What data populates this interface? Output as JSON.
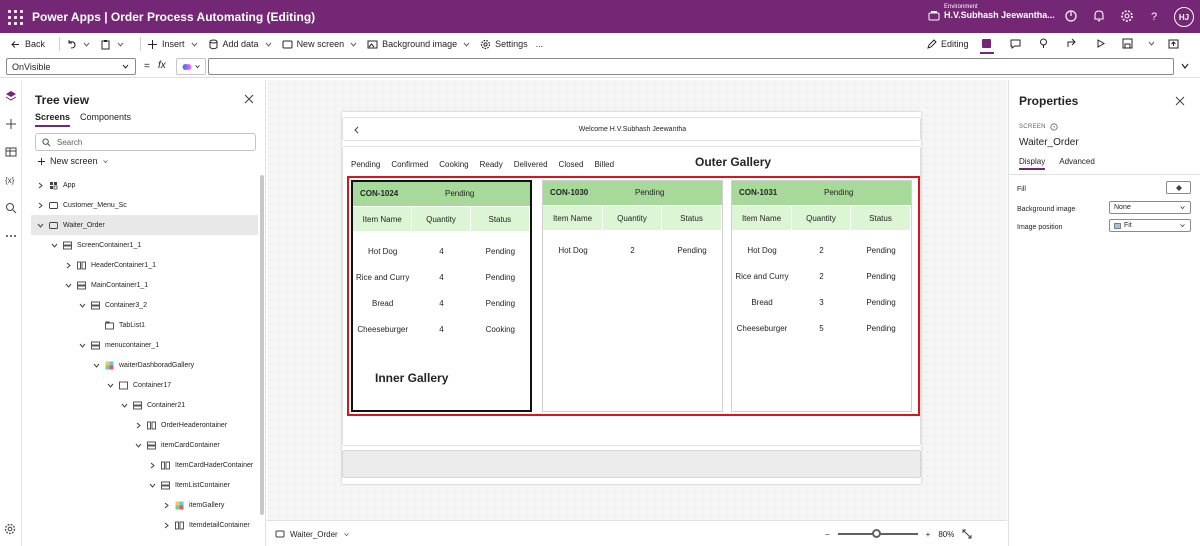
{
  "app": {
    "title": "Power Apps  |  Order Process Automating (Editing)",
    "env_label": "Environment",
    "env_value": "H.V.Subhash Jeewantha...",
    "avatar_initials": "HJ"
  },
  "commands": {
    "back": "Back",
    "insert": "Insert",
    "add_data": "Add data",
    "new_screen": "New screen",
    "background_image": "Background image",
    "settings": "Settings",
    "more": "...",
    "editing": "Editing"
  },
  "formula": {
    "property": "OnVisible",
    "fx": "fx",
    "value": ""
  },
  "tree": {
    "title": "Tree view",
    "tabs": [
      "Screens",
      "Components"
    ],
    "search_placeholder": "Search",
    "new_screen": "New screen",
    "nodes": [
      {
        "label": "App"
      },
      {
        "label": "Customer_Menu_Sc"
      },
      {
        "label": "Waiter_Order"
      },
      {
        "label": "ScreenContainer1_1"
      },
      {
        "label": "HeaderContainer1_1"
      },
      {
        "label": "MainContainer1_1"
      },
      {
        "label": "Container3_2"
      },
      {
        "label": "TabList1"
      },
      {
        "label": "menucontainer_1"
      },
      {
        "label": "waiterDashboradGallery"
      },
      {
        "label": "Container17"
      },
      {
        "label": "Container21"
      },
      {
        "label": "OrderHeaderontainer"
      },
      {
        "label": "itemCardContainer"
      },
      {
        "label": "ItemCardHaderContainer"
      },
      {
        "label": "ItemListContainer"
      },
      {
        "label": "itemGallery"
      },
      {
        "label": "ItemdetailContainer"
      }
    ]
  },
  "canvas": {
    "welcome": "Welcome H.V.Subhash Jeewantha",
    "status_tabs": [
      "Pending",
      "Confirmed",
      "Cooking",
      "Ready",
      "Delivered",
      "Closed",
      "Billed"
    ],
    "outer_label": "Outer Gallery",
    "inner_label": "Inner Gallery",
    "columns": [
      "Item Name",
      "Quantity",
      "Status"
    ],
    "orders": [
      {
        "id": "CON-1024",
        "status": "Pending",
        "items": [
          {
            "name": "Hot Dog",
            "qty": "4",
            "status": "Pending"
          },
          {
            "name": "Rice and Curry",
            "qty": "4",
            "status": "Pending"
          },
          {
            "name": "Bread",
            "qty": "4",
            "status": "Pending"
          },
          {
            "name": "Cheeseburger",
            "qty": "4",
            "status": "Cooking"
          }
        ]
      },
      {
        "id": "CON-1030",
        "status": "Pending",
        "items": [
          {
            "name": "Hot Dog",
            "qty": "2",
            "status": "Pending"
          }
        ]
      },
      {
        "id": "CON-1031",
        "status": "Pending",
        "items": [
          {
            "name": "Hot Dog",
            "qty": "2",
            "status": "Pending"
          },
          {
            "name": "Rice and Curry",
            "qty": "2",
            "status": "Pending"
          },
          {
            "name": "Bread",
            "qty": "3",
            "status": "Pending"
          },
          {
            "name": "Cheeseburger",
            "qty": "5",
            "status": "Pending"
          }
        ]
      }
    ]
  },
  "statusbar": {
    "screen": "Waiter_Order",
    "zoom": "80%",
    "zoom_minus": "−",
    "zoom_plus": "+"
  },
  "properties": {
    "title": "Properties",
    "screen_label": "SCREEN",
    "screen_name": "Waiter_Order",
    "tabs": [
      "Display",
      "Advanced"
    ],
    "fill_label": "Fill",
    "bg_image_label": "Background image",
    "bg_image_value": "None",
    "img_pos_label": "Image position",
    "img_pos_value": "Fit"
  },
  "colors": {
    "brand": "#742774",
    "order_header": "#a6d99a",
    "column_header": "#dcf5d4",
    "outer_gallery_border": "#d9141a"
  }
}
